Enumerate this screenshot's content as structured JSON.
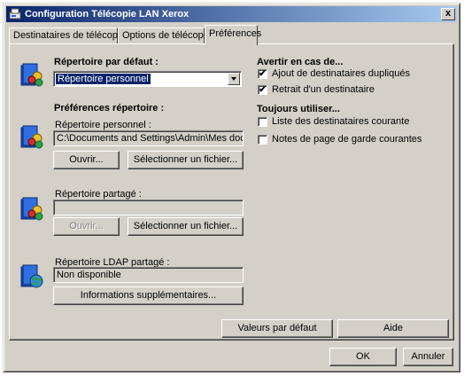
{
  "window": {
    "title": "Configuration Télécopie LAN Xerox",
    "close_symbol": "x"
  },
  "tabs": [
    {
      "label": "Destinataires de télécopie"
    },
    {
      "label": "Options de télécopie"
    },
    {
      "label": "Préférences"
    }
  ],
  "default_dir": {
    "heading": "Répertoire par défaut :",
    "selected": "Répertoire personnel"
  },
  "dir_prefs": {
    "heading": "Préférences répertoire :",
    "personal": {
      "label": "Répertoire personnel :",
      "value": "C:\\Documents and Settings\\Admin\\Mes documen",
      "open": "Ouvrir...",
      "select": "Sélectionner un fichier..."
    },
    "shared": {
      "label": "Répertoire partagé :",
      "value": "",
      "open": "Ouvrir...",
      "select": "Sélectionner un fichier..."
    },
    "ldap": {
      "label": "Répertoire LDAP partagé :",
      "value": "Non disponible",
      "more": "Informations supplémentaires..."
    }
  },
  "warn": {
    "heading": "Avertir en cas de...",
    "items": [
      {
        "label": "Ajout de destinataires dupliqués",
        "checked": true
      },
      {
        "label": "Retrait d'un destinataire",
        "checked": true
      }
    ]
  },
  "always": {
    "heading": "Toujours utiliser...",
    "items": [
      {
        "label": "Liste des destinataires courante",
        "checked": false
      },
      {
        "label": "Notes de page de garde courantes",
        "checked": false
      }
    ]
  },
  "panel_buttons": {
    "defaults": "Valeurs par défaut",
    "help": "Aide"
  },
  "footer": {
    "ok": "OK",
    "cancel": "Annuler"
  },
  "check_mark": "✔"
}
